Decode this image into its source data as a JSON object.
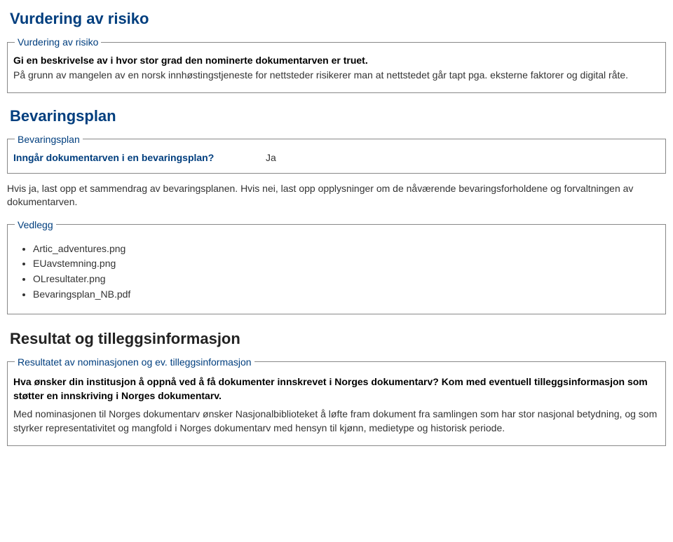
{
  "risk": {
    "section_title": "Vurdering av risiko",
    "legend": "Vurdering av risiko",
    "prompt": "Gi en beskrivelse av i hvor stor grad den nominerte dokumentarven er truet.",
    "body": "På grunn av mangelen av en norsk innhøstingstjeneste for nettsteder risikerer man at nettstedet går tapt pga. eksterne faktorer og digital råte."
  },
  "preservation": {
    "section_title": "Bevaringsplan",
    "legend": "Bevaringsplan",
    "question": "Inngår dokumentarven i en bevaringsplan?",
    "answer": "Ja",
    "instruction": "Hvis ja, last opp et sammendrag av bevaringsplanen. Hvis nei, last opp opplysninger om de nåværende bevaringsforholdene og forvaltningen av dokumentarven."
  },
  "attachments": {
    "legend": "Vedlegg",
    "items": [
      "Artic_adventures.png",
      "EUavstemning.png",
      "OLresultater.png",
      "Bevaringsplan_NB.pdf"
    ]
  },
  "result": {
    "section_title": "Resultat og tilleggsinformasjon",
    "legend": "Resultatet av nominasjonen og ev. tilleggsinformasjon",
    "question": "Hva ønsker din institusjon å oppnå ved å få dokumenter innskrevet i Norges dokumentarv? Kom med eventuell tilleggsinformasjon som støtter en innskriving i Norges dokumentarv.",
    "answer": "Med nominasjonen til Norges dokumentarv ønsker Nasjonalbiblioteket å løfte fram dokument fra samlingen som har stor nasjonal betydning, og som styrker representativitet og mangfold i Norges dokumentarv med hensyn til kjønn, medietype og historisk periode."
  }
}
